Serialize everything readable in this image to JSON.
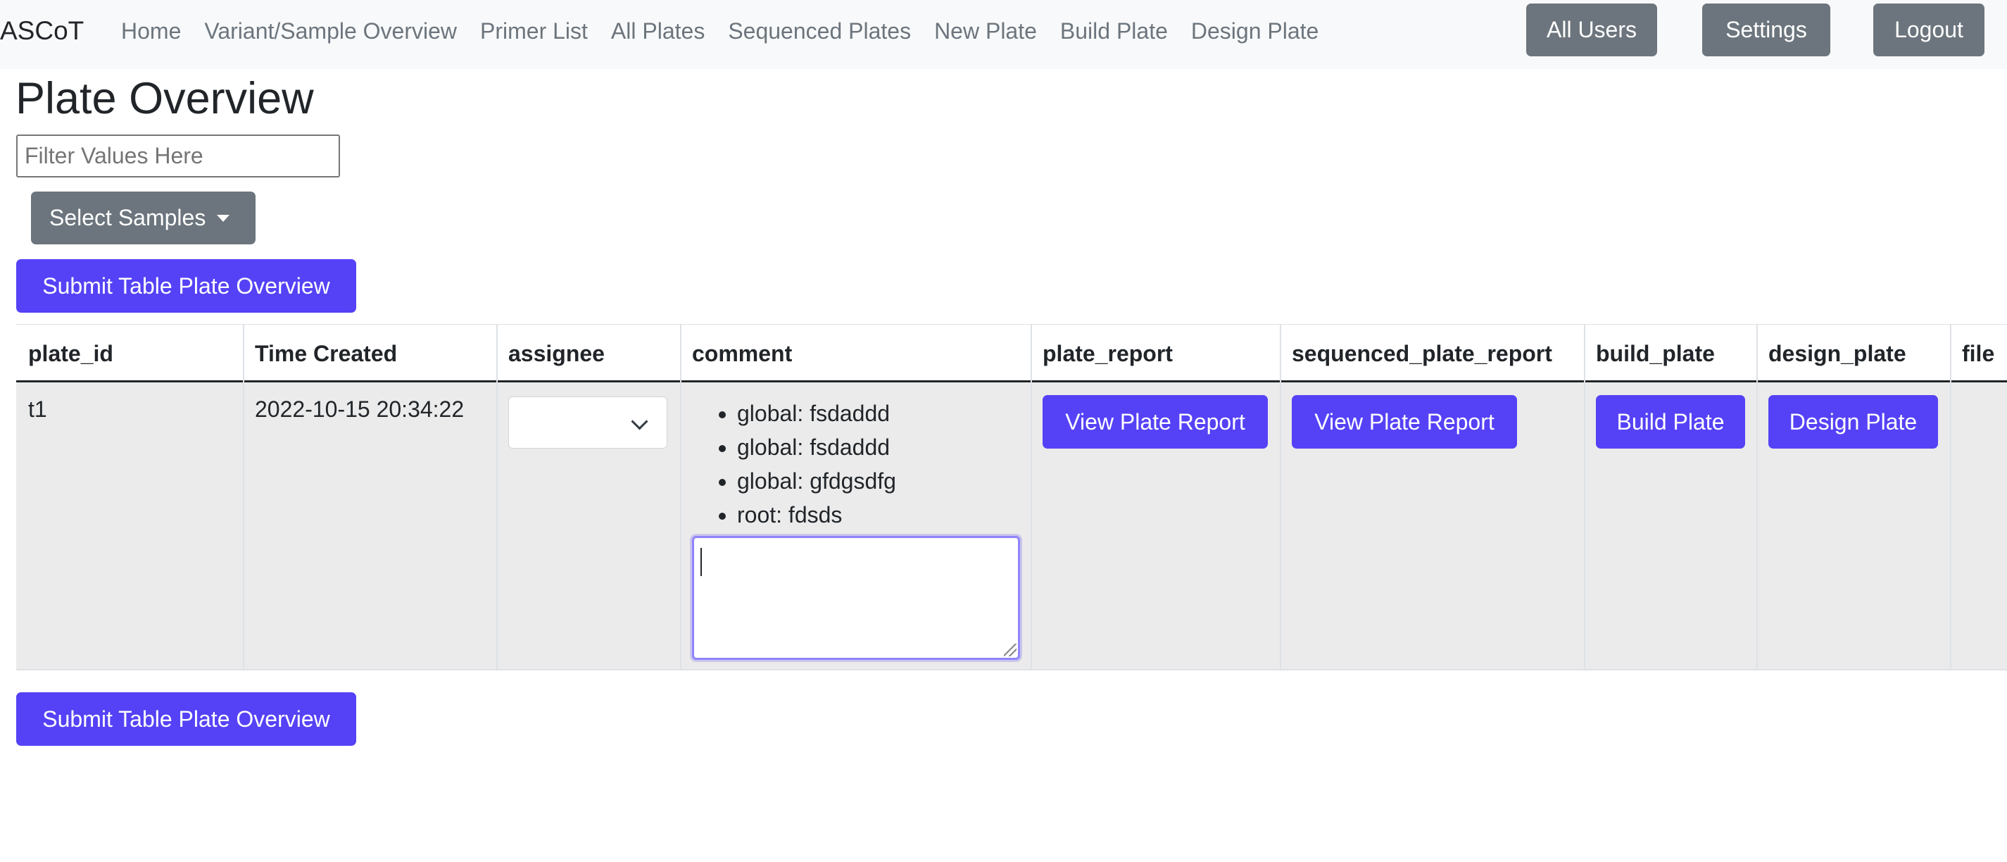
{
  "navbar": {
    "brand": "ASCoT",
    "links": [
      "Home",
      "Variant/Sample Overview",
      "Primer List",
      "All Plates",
      "Sequenced Plates",
      "New Plate",
      "Build Plate",
      "Design Plate"
    ],
    "buttons": {
      "all_users": "All Users",
      "settings": "Settings",
      "logout": "Logout"
    }
  },
  "page": {
    "title": "Plate Overview",
    "filter_placeholder": "Filter Values Here",
    "filter_value": "",
    "select_samples_label": "Select Samples",
    "submit_label": "Submit Table Plate Overview"
  },
  "table": {
    "columns": [
      "plate_id",
      "Time Created",
      "assignee",
      "comment",
      "plate_report",
      "sequenced_plate_report",
      "build_plate",
      "design_plate",
      "file"
    ],
    "rows": [
      {
        "plate_id": "t1",
        "time_created": "2022-10-15 20:34:22",
        "assignee": "",
        "comments": [
          "global: fsdaddd",
          "global: fsdaddd",
          "global: gfdgsdfg",
          "root: fdsds"
        ],
        "new_comment": "",
        "plate_report_label": "View Plate Report",
        "sequenced_plate_report_label": "View Plate Report",
        "build_plate_label": "Build Plate",
        "design_plate_label": "Design Plate"
      }
    ]
  },
  "colors": {
    "primary": "#5542f6",
    "secondary": "#6c757d",
    "navbar_bg": "#f8f9fa",
    "row_bg": "#ebebeb"
  },
  "icons": {
    "select_samples_caret": "caret-down-icon",
    "assignee_chevron": "chevron-down-icon",
    "textarea_resize": "resize-grip-icon"
  }
}
